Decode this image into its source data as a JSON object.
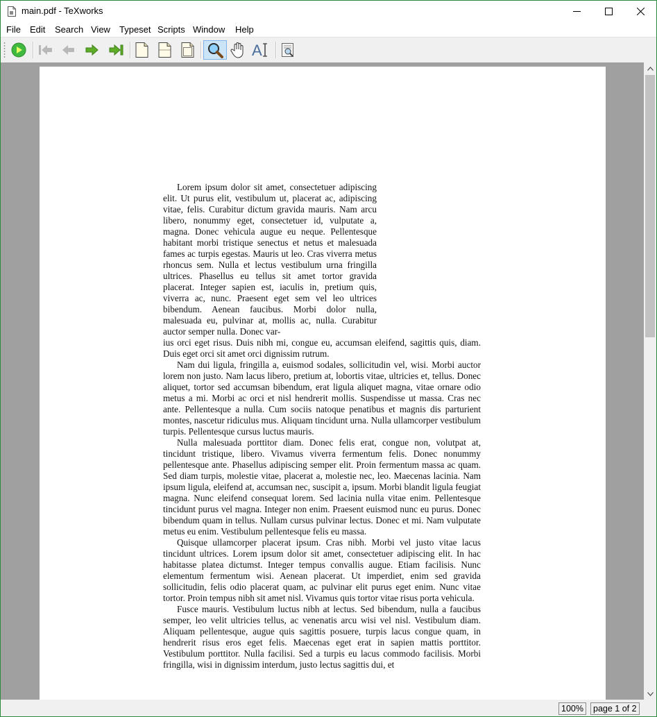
{
  "window": {
    "title": "main.pdf - TeXworks"
  },
  "menu": [
    "File",
    "Edit",
    "Search",
    "View",
    "Typeset",
    "Scripts",
    "Window",
    "Help"
  ],
  "toolbar": {
    "icons": [
      "typeset-run-icon",
      "first-page-icon",
      "previous-page-icon",
      "next-page-icon",
      "last-page-icon",
      "actual-size-icon",
      "fit-width-icon",
      "fit-window-icon",
      "magnify-tool-icon",
      "scroll-hand-icon",
      "select-text-icon",
      "goto-source-icon"
    ]
  },
  "document": {
    "first_para_narrow": "Lorem ipsum dolor sit amet, consectetuer adipiscing elit. Ut purus elit, vestibulum ut, placerat ac, adipiscing vitae, felis. Curabitur dictum gravida mauris. Nam arcu libero, nonummy eget, consectetuer id, vulputate a, magna. Donec vehicula augue eu neque. Pellentesque habitant morbi tristique senectus et netus et malesuada fames ac turpis egestas. Mauris ut leo. Cras viverra metus rhoncus sem. Nulla et lectus vestibulum urna fringilla ultrices. Phasellus eu tellus sit amet tortor gravida placerat. Integer sapien est, iaculis in, pretium quis, viverra ac, nunc. Praesent eget sem vel leo ultrices bibendum. Aenean faucibus. Morbi dolor nulla, malesuada eu, pulvinar at, mollis ac, nulla. Curabitur auctor semper nulla. Donec var-",
    "first_para_wide": "ius orci eget risus. Duis nibh mi, congue eu, accumsan eleifend, sagittis quis, diam. Duis eget orci sit amet orci dignissim rutrum.",
    "paragraphs": [
      "Nam dui ligula, fringilla a, euismod sodales, sollicitudin vel, wisi. Morbi auctor lorem non justo. Nam lacus libero, pretium at, lobortis vitae, ultricies et, tellus. Donec aliquet, tortor sed accumsan bibendum, erat ligula aliquet magna, vitae ornare odio metus a mi. Morbi ac orci et nisl hendrerit mollis. Suspendisse ut massa. Cras nec ante. Pellentesque a nulla. Cum sociis natoque penatibus et magnis dis parturient montes, nascetur ridiculus mus. Aliquam tincidunt urna. Nulla ullamcorper vestibulum turpis. Pellentesque cursus luctus mauris.",
      "Nulla malesuada porttitor diam. Donec felis erat, congue non, volutpat at, tincidunt tristique, libero. Vivamus viverra fermentum felis. Donec nonummy pellentesque ante. Phasellus adipiscing semper elit. Proin fermentum massa ac quam. Sed diam turpis, molestie vitae, placerat a, molestie nec, leo. Maecenas lacinia. Nam ipsum ligula, eleifend at, accumsan nec, suscipit a, ipsum. Morbi blandit ligula feugiat magna. Nunc eleifend consequat lorem. Sed lacinia nulla vitae enim. Pellentesque tincidunt purus vel magna. Integer non enim. Praesent euismod nunc eu purus. Donec bibendum quam in tellus. Nullam cursus pulvinar lectus. Donec et mi. Nam vulputate metus eu enim. Vestibulum pellentesque felis eu massa.",
      "Quisque ullamcorper placerat ipsum. Cras nibh. Morbi vel justo vitae lacus tincidunt ultrices. Lorem ipsum dolor sit amet, consectetuer adipiscing elit. In hac habitasse platea dictumst. Integer tempus convallis augue. Etiam facilisis. Nunc elementum fermentum wisi. Aenean placerat. Ut imperdiet, enim sed gravida sollicitudin, felis odio placerat quam, ac pulvinar elit purus eget enim. Nunc vitae tortor. Proin tempus nibh sit amet nisl. Vivamus quis tortor vitae risus porta vehicula.",
      "Fusce mauris. Vestibulum luctus nibh at lectus. Sed bibendum, nulla a faucibus semper, leo velit ultricies tellus, ac venenatis arcu wisi vel nisl. Vestibulum diam. Aliquam pellentesque, augue quis sagittis posuere, turpis lacus congue quam, in hendrerit risus eros eget felis. Maecenas eget erat in sapien mattis porttitor. Vestibulum porttitor. Nulla facilisi. Sed a turpis eu lacus commodo facilisis. Morbi fringilla, wisi in dignissim interdum, justo lectus sagittis dui, et"
    ]
  },
  "status": {
    "zoom": "100%",
    "page": "page 1 of 2"
  }
}
